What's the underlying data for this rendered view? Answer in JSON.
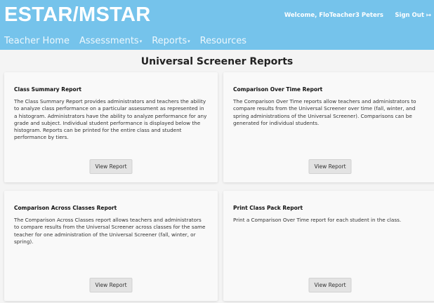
{
  "header": {
    "brand": "ESTAR/MSTAR",
    "welcome": "Welcome, FloTeacher3 Peters",
    "sign_out": "Sign Out",
    "nav": [
      {
        "label": "Teacher Home",
        "dropdown": false
      },
      {
        "label": "Assessments",
        "dropdown": true
      },
      {
        "label": "Reports",
        "dropdown": true
      },
      {
        "label": "Resources",
        "dropdown": false
      }
    ]
  },
  "page_title": "Universal Screener Reports",
  "cards": [
    {
      "title": "Class Summary Report",
      "description": "The Class Summary Report provides administrators and teachers the ability to analyze class performance on a particular assessment as represented in a histogram. Administrators have the ability to analyze performance for any grade and subject. Individual student performance is displayed below the histogram. Reports can be printed for the entire class and student performance by tiers.",
      "button": "View Report"
    },
    {
      "title": "Comparison Over Time Report",
      "description": "The Comparison Over Time reports allow teachers and administrators to compare results from the Universal Screener over time (fall, winter, and spring administrations of the Universal Screener). Comparisons can be generated for individual students.",
      "button": "View Report"
    },
    {
      "title": "Comparison Across Classes Report",
      "description": "The Comparison Across Classes report allows teachers and administrators to compare results from the Universal Screener across classes for the same teacher for one administration of the Universal Screener (fall, winter, or spring).",
      "button": "View Report"
    },
    {
      "title": "Print Class Pack Report",
      "description": "Print a Comparison Over Time report for each student in the class.",
      "button": "View Report"
    }
  ],
  "colors": {
    "header_bg": "#75c3eb",
    "page_bg": "#f4f4f4"
  }
}
